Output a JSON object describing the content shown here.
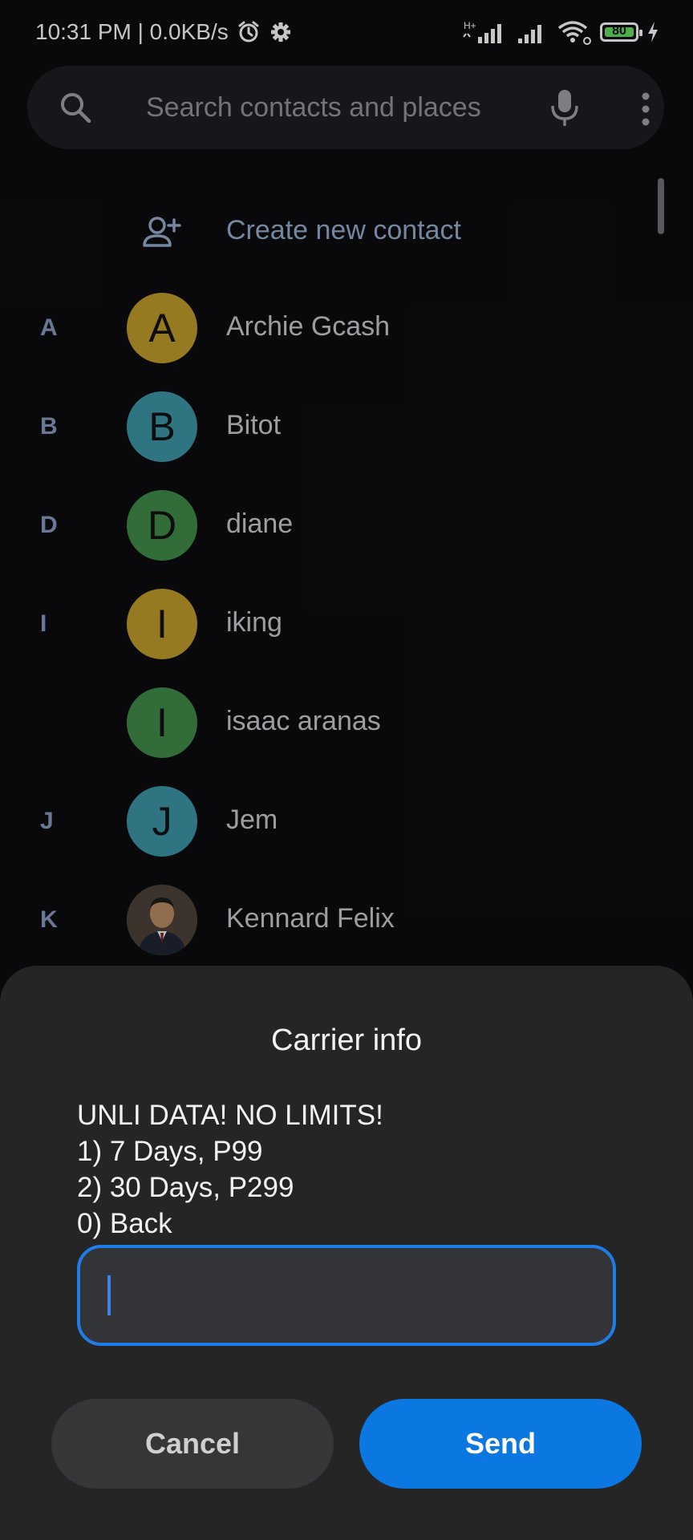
{
  "status_bar": {
    "time_speed": "10:31 PM | 0.0KB/s",
    "network_type": "H+",
    "battery_level": "80",
    "battery_color": "#5fd45f"
  },
  "search": {
    "placeholder": "Search contacts and places"
  },
  "create_contact": {
    "label": "Create new contact"
  },
  "contacts": [
    {
      "section": "A",
      "initial": "A",
      "name": "Archie Gcash",
      "color": "#b8952a"
    },
    {
      "section": "B",
      "initial": "B",
      "name": "Bitot",
      "color": "#3a8f9e"
    },
    {
      "section": "D",
      "initial": "D",
      "name": "diane",
      "color": "#3d8446"
    },
    {
      "section": "I",
      "initial": "I",
      "name": "iking",
      "color": "#b8952a"
    },
    {
      "section": "",
      "initial": "I",
      "name": "isaac aranas",
      "color": "#3d8446"
    },
    {
      "section": "J",
      "initial": "J",
      "name": "Jem",
      "color": "#3a8f9e"
    },
    {
      "section": "K",
      "initial": "",
      "name": "Kennard Felix",
      "color": "#3b3530"
    }
  ],
  "dialog": {
    "title": "Carrier info",
    "message_lines": [
      "UNLI DATA! NO LIMITS!",
      "1) 7 Days, P99",
      "2) 30 Days, P299",
      "0) Back"
    ],
    "input_value": "",
    "cancel_label": "Cancel",
    "send_label": "Send",
    "accent_color": "#0a78e0"
  }
}
